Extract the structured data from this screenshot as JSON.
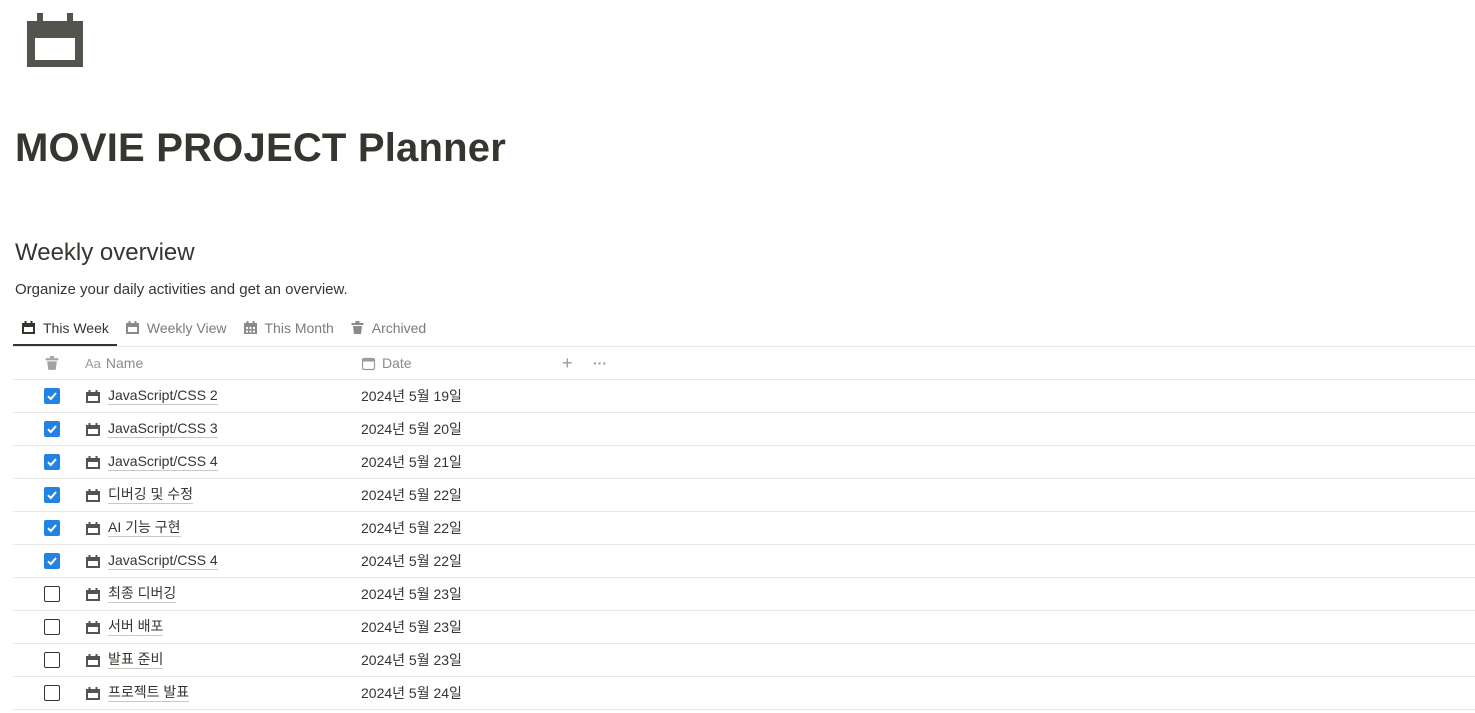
{
  "page": {
    "icon": "calendar-icon",
    "title": "MOVIE PROJECT Planner"
  },
  "section": {
    "heading": "Weekly overview",
    "description": "Organize your daily activities and get an overview."
  },
  "tabs": [
    {
      "label": "This Week",
      "icon": "calendar-icon",
      "active": true
    },
    {
      "label": "Weekly View",
      "icon": "calendar-icon",
      "active": false
    },
    {
      "label": "This Month",
      "icon": "calendar-grid-icon",
      "active": false
    },
    {
      "label": "Archived",
      "icon": "trash-icon",
      "active": false
    }
  ],
  "table": {
    "headers": {
      "check_icon": "trash-icon",
      "name_prefix": "Aa",
      "name": "Name",
      "date": "Date",
      "add": "+",
      "more": "···"
    },
    "rows": [
      {
        "checked": true,
        "name": "JavaScript/CSS 2",
        "date": "2024년 5월 19일"
      },
      {
        "checked": true,
        "name": "JavaScript/CSS 3",
        "date": "2024년 5월 20일"
      },
      {
        "checked": true,
        "name": "JavaScript/CSS 4",
        "date": "2024년 5월 21일"
      },
      {
        "checked": true,
        "name": "디버깅 및 수정",
        "date": "2024년 5월 22일"
      },
      {
        "checked": true,
        "name": "AI 기능 구현",
        "date": "2024년 5월 22일"
      },
      {
        "checked": true,
        "name": "JavaScript/CSS 4",
        "date": "2024년 5월 22일"
      },
      {
        "checked": false,
        "name": "최종 디버깅",
        "date": "2024년 5월 23일"
      },
      {
        "checked": false,
        "name": "서버 배포",
        "date": "2024년 5월 23일"
      },
      {
        "checked": false,
        "name": "발표 준비",
        "date": "2024년 5월 23일"
      },
      {
        "checked": false,
        "name": "프로젝트 발표",
        "date": "2024년 5월 24일"
      }
    ]
  },
  "colors": {
    "text": "#37352f",
    "muted": "#7d7b77",
    "checkbox_checked": "#2383e2",
    "divider": "#e9e9e7"
  }
}
